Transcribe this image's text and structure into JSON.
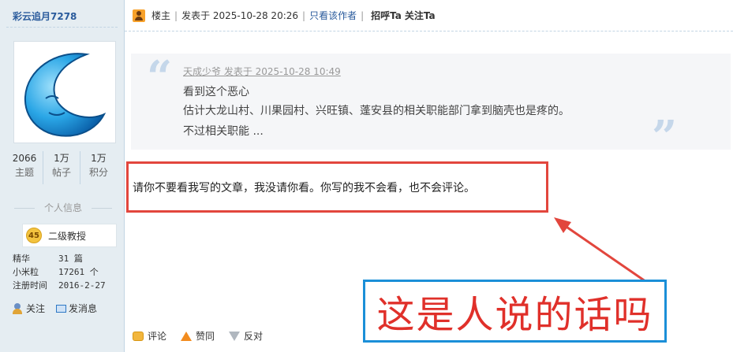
{
  "user": {
    "name": "彩云追月7278",
    "stats": [
      {
        "value": "2066",
        "label": "主题"
      },
      {
        "value": "1万",
        "label": "帖子"
      },
      {
        "value": "1万",
        "label": "积分"
      }
    ],
    "section_title": "个人信息",
    "level": {
      "badge": "45",
      "title": "二级教授"
    },
    "info": [
      {
        "key": "精华",
        "value": "31 篇"
      },
      {
        "key": "小米粒",
        "value": "17261 个"
      },
      {
        "key": "注册时间",
        "value": "2016-2-27"
      }
    ],
    "actions": {
      "follow": "关注",
      "message": "发消息"
    }
  },
  "post_header": {
    "floor": "楼主",
    "posted": "发表于 2025-10-28 20:26",
    "separator": "|",
    "only_author": "只看该作者",
    "greet": "招呼Ta",
    "follow": "关注Ta"
  },
  "quote": {
    "meta": "天成少爷 发表于 2025-10-28 10:49",
    "lines": [
      "看到这个恶心",
      "估计大龙山村、川果园村、兴旺镇、蓬安县的相关职能部门拿到脑壳也是疼的。",
      "不过相关职能 ..."
    ]
  },
  "post_body": "请你不要看我写的文章，我没请你看。你写的我不会看，也不会评论。",
  "annotation": {
    "text": "这是人说的话吗",
    "text_color": "#e0302a",
    "box_color": "#1b8fd8",
    "highlight_color": "#e2463d"
  },
  "post_footer": {
    "comment": "评论",
    "upvote": "赞同",
    "downvote": "反对"
  }
}
